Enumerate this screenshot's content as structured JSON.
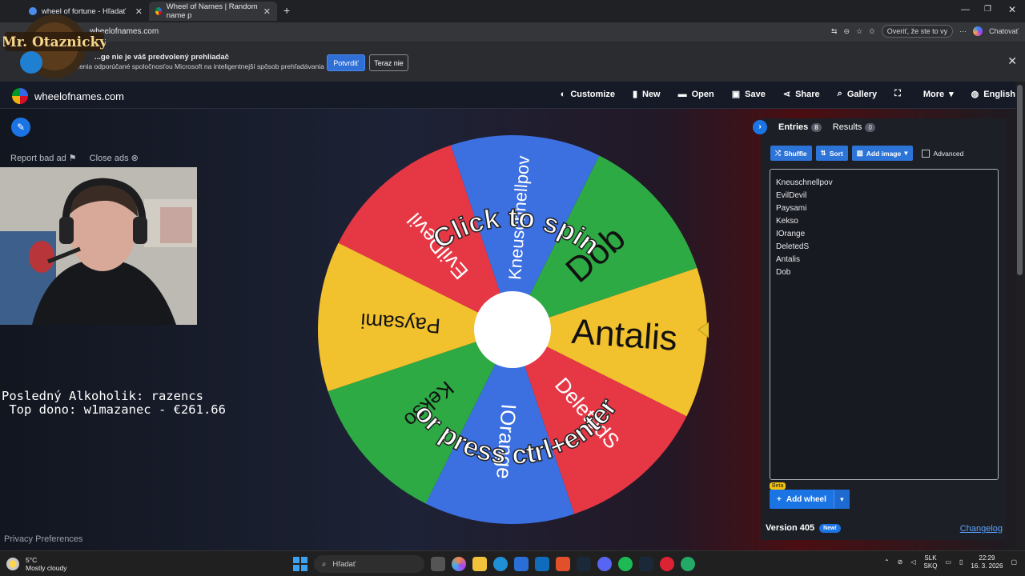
{
  "browser": {
    "tabs": [
      {
        "label": "wheel of fortune - Hľadať"
      },
      {
        "label": "Wheel of Names | Random name p"
      }
    ],
    "url": "wheelofnames.com",
    "verify_label": "Overiť, že ste to vy",
    "chat_label": "Chatovať"
  },
  "infobar": {
    "title": "...ge nie je váš predvolený prehliadač",
    "subtitle": "...enia odporúčané spoločnosťou Microsoft na inteligentnejší spôsob prehľadávania",
    "confirm_label": "Potvrdiť",
    "decline_label": "Teraz nie"
  },
  "overlay": {
    "badge_text": "Mr. Otaznicky",
    "line1": "Posledný Alkoholik: razencs",
    "line2": " Top dono: w1mazanec - €261.66"
  },
  "site": {
    "brand": "wheelofnames.com",
    "nav": [
      {
        "label": "Customize",
        "icon": "palette-icon",
        "glyph": "◐"
      },
      {
        "label": "New",
        "icon": "file-icon",
        "glyph": "▮"
      },
      {
        "label": "Open",
        "icon": "folder-icon",
        "glyph": "▬"
      },
      {
        "label": "Save",
        "icon": "save-icon",
        "glyph": "▣"
      },
      {
        "label": "Share",
        "icon": "share-icon",
        "glyph": "⋖"
      },
      {
        "label": "Gallery",
        "icon": "search-icon",
        "glyph": "⌕"
      },
      {
        "label": "",
        "icon": "fullscreen-icon",
        "glyph": "⛶"
      },
      {
        "label": "More",
        "icon": "chevron-down-icon",
        "glyph": "▾"
      },
      {
        "label": "English",
        "icon": "globe-icon",
        "glyph": "◍"
      }
    ],
    "report_label": "Report bad ad",
    "close_ads_label": "Close ads",
    "privacy_label": "Privacy Preferences"
  },
  "wheel": {
    "spin_text": "Click to spin",
    "press_text": "or press ctrl+enter",
    "slices": [
      {
        "name": "Antalis",
        "color": "#f2c12e"
      },
      {
        "name": "DeletedS",
        "color": "#e63745"
      },
      {
        "name": "IOrange",
        "color": "#3c6fe0"
      },
      {
        "name": "Kekso",
        "color": "#2eaa44"
      },
      {
        "name": "Paysami",
        "color": "#f2c12e"
      },
      {
        "name": "EvilDevil",
        "color": "#e63745"
      },
      {
        "name": "Kneuschnellpov",
        "color": "#3c6fe0"
      },
      {
        "name": "Dob",
        "color": "#2eaa44"
      }
    ]
  },
  "panel": {
    "entries_label": "Entries",
    "entries_count": "8",
    "results_label": "Results",
    "results_count": "0",
    "shuffle_label": "Shuffle",
    "sort_label": "Sort",
    "add_image_label": "Add image",
    "advanced_label": "Advanced",
    "entries": [
      "Kneuschnellpov",
      "EvilDevil",
      "Paysami",
      "Kekso",
      "IOrange",
      "DeletedS",
      "Antalis",
      "Dob"
    ],
    "beta_label": "Beta",
    "add_wheel_label": "Add wheel",
    "version_label": "Version 405",
    "new_label": "New!",
    "changelog_label": "Changelog"
  },
  "taskbar": {
    "temp": "5°C",
    "weather": "Mostly cloudy",
    "search_placeholder": "Hľadať",
    "lang1": "SLK",
    "lang2": "SKQ",
    "time": "22:29",
    "date": "16. 3. 2026"
  }
}
